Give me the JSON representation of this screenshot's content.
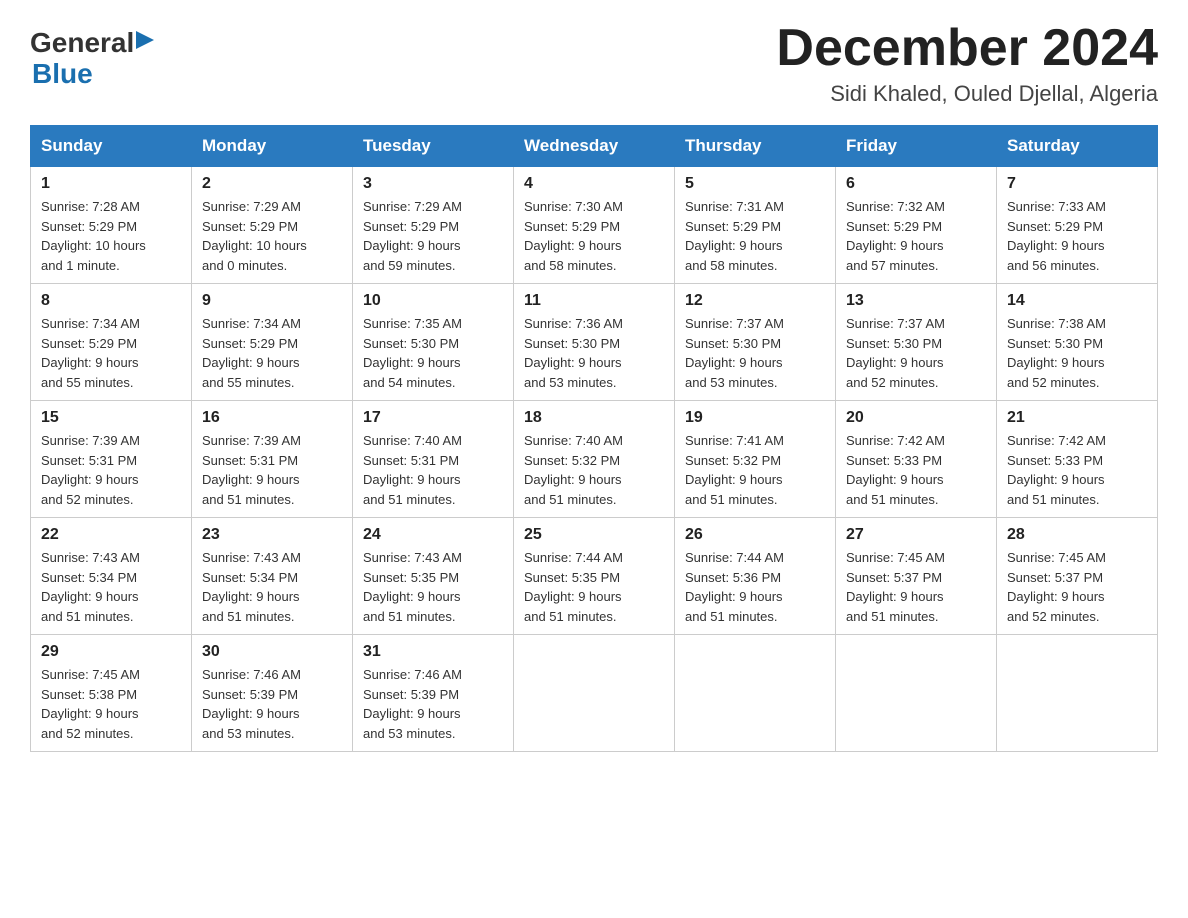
{
  "header": {
    "logo_general": "General",
    "logo_blue": "Blue",
    "title": "December 2024",
    "subtitle": "Sidi Khaled, Ouled Djellal, Algeria"
  },
  "weekdays": [
    "Sunday",
    "Monday",
    "Tuesday",
    "Wednesday",
    "Thursday",
    "Friday",
    "Saturday"
  ],
  "weeks": [
    [
      {
        "day": "1",
        "info": "Sunrise: 7:28 AM\nSunset: 5:29 PM\nDaylight: 10 hours\nand 1 minute."
      },
      {
        "day": "2",
        "info": "Sunrise: 7:29 AM\nSunset: 5:29 PM\nDaylight: 10 hours\nand 0 minutes."
      },
      {
        "day": "3",
        "info": "Sunrise: 7:29 AM\nSunset: 5:29 PM\nDaylight: 9 hours\nand 59 minutes."
      },
      {
        "day": "4",
        "info": "Sunrise: 7:30 AM\nSunset: 5:29 PM\nDaylight: 9 hours\nand 58 minutes."
      },
      {
        "day": "5",
        "info": "Sunrise: 7:31 AM\nSunset: 5:29 PM\nDaylight: 9 hours\nand 58 minutes."
      },
      {
        "day": "6",
        "info": "Sunrise: 7:32 AM\nSunset: 5:29 PM\nDaylight: 9 hours\nand 57 minutes."
      },
      {
        "day": "7",
        "info": "Sunrise: 7:33 AM\nSunset: 5:29 PM\nDaylight: 9 hours\nand 56 minutes."
      }
    ],
    [
      {
        "day": "8",
        "info": "Sunrise: 7:34 AM\nSunset: 5:29 PM\nDaylight: 9 hours\nand 55 minutes."
      },
      {
        "day": "9",
        "info": "Sunrise: 7:34 AM\nSunset: 5:29 PM\nDaylight: 9 hours\nand 55 minutes."
      },
      {
        "day": "10",
        "info": "Sunrise: 7:35 AM\nSunset: 5:30 PM\nDaylight: 9 hours\nand 54 minutes."
      },
      {
        "day": "11",
        "info": "Sunrise: 7:36 AM\nSunset: 5:30 PM\nDaylight: 9 hours\nand 53 minutes."
      },
      {
        "day": "12",
        "info": "Sunrise: 7:37 AM\nSunset: 5:30 PM\nDaylight: 9 hours\nand 53 minutes."
      },
      {
        "day": "13",
        "info": "Sunrise: 7:37 AM\nSunset: 5:30 PM\nDaylight: 9 hours\nand 52 minutes."
      },
      {
        "day": "14",
        "info": "Sunrise: 7:38 AM\nSunset: 5:30 PM\nDaylight: 9 hours\nand 52 minutes."
      }
    ],
    [
      {
        "day": "15",
        "info": "Sunrise: 7:39 AM\nSunset: 5:31 PM\nDaylight: 9 hours\nand 52 minutes."
      },
      {
        "day": "16",
        "info": "Sunrise: 7:39 AM\nSunset: 5:31 PM\nDaylight: 9 hours\nand 51 minutes."
      },
      {
        "day": "17",
        "info": "Sunrise: 7:40 AM\nSunset: 5:31 PM\nDaylight: 9 hours\nand 51 minutes."
      },
      {
        "day": "18",
        "info": "Sunrise: 7:40 AM\nSunset: 5:32 PM\nDaylight: 9 hours\nand 51 minutes."
      },
      {
        "day": "19",
        "info": "Sunrise: 7:41 AM\nSunset: 5:32 PM\nDaylight: 9 hours\nand 51 minutes."
      },
      {
        "day": "20",
        "info": "Sunrise: 7:42 AM\nSunset: 5:33 PM\nDaylight: 9 hours\nand 51 minutes."
      },
      {
        "day": "21",
        "info": "Sunrise: 7:42 AM\nSunset: 5:33 PM\nDaylight: 9 hours\nand 51 minutes."
      }
    ],
    [
      {
        "day": "22",
        "info": "Sunrise: 7:43 AM\nSunset: 5:34 PM\nDaylight: 9 hours\nand 51 minutes."
      },
      {
        "day": "23",
        "info": "Sunrise: 7:43 AM\nSunset: 5:34 PM\nDaylight: 9 hours\nand 51 minutes."
      },
      {
        "day": "24",
        "info": "Sunrise: 7:43 AM\nSunset: 5:35 PM\nDaylight: 9 hours\nand 51 minutes."
      },
      {
        "day": "25",
        "info": "Sunrise: 7:44 AM\nSunset: 5:35 PM\nDaylight: 9 hours\nand 51 minutes."
      },
      {
        "day": "26",
        "info": "Sunrise: 7:44 AM\nSunset: 5:36 PM\nDaylight: 9 hours\nand 51 minutes."
      },
      {
        "day": "27",
        "info": "Sunrise: 7:45 AM\nSunset: 5:37 PM\nDaylight: 9 hours\nand 51 minutes."
      },
      {
        "day": "28",
        "info": "Sunrise: 7:45 AM\nSunset: 5:37 PM\nDaylight: 9 hours\nand 52 minutes."
      }
    ],
    [
      {
        "day": "29",
        "info": "Sunrise: 7:45 AM\nSunset: 5:38 PM\nDaylight: 9 hours\nand 52 minutes."
      },
      {
        "day": "30",
        "info": "Sunrise: 7:46 AM\nSunset: 5:39 PM\nDaylight: 9 hours\nand 53 minutes."
      },
      {
        "day": "31",
        "info": "Sunrise: 7:46 AM\nSunset: 5:39 PM\nDaylight: 9 hours\nand 53 minutes."
      },
      {
        "day": "",
        "info": ""
      },
      {
        "day": "",
        "info": ""
      },
      {
        "day": "",
        "info": ""
      },
      {
        "day": "",
        "info": ""
      }
    ]
  ]
}
